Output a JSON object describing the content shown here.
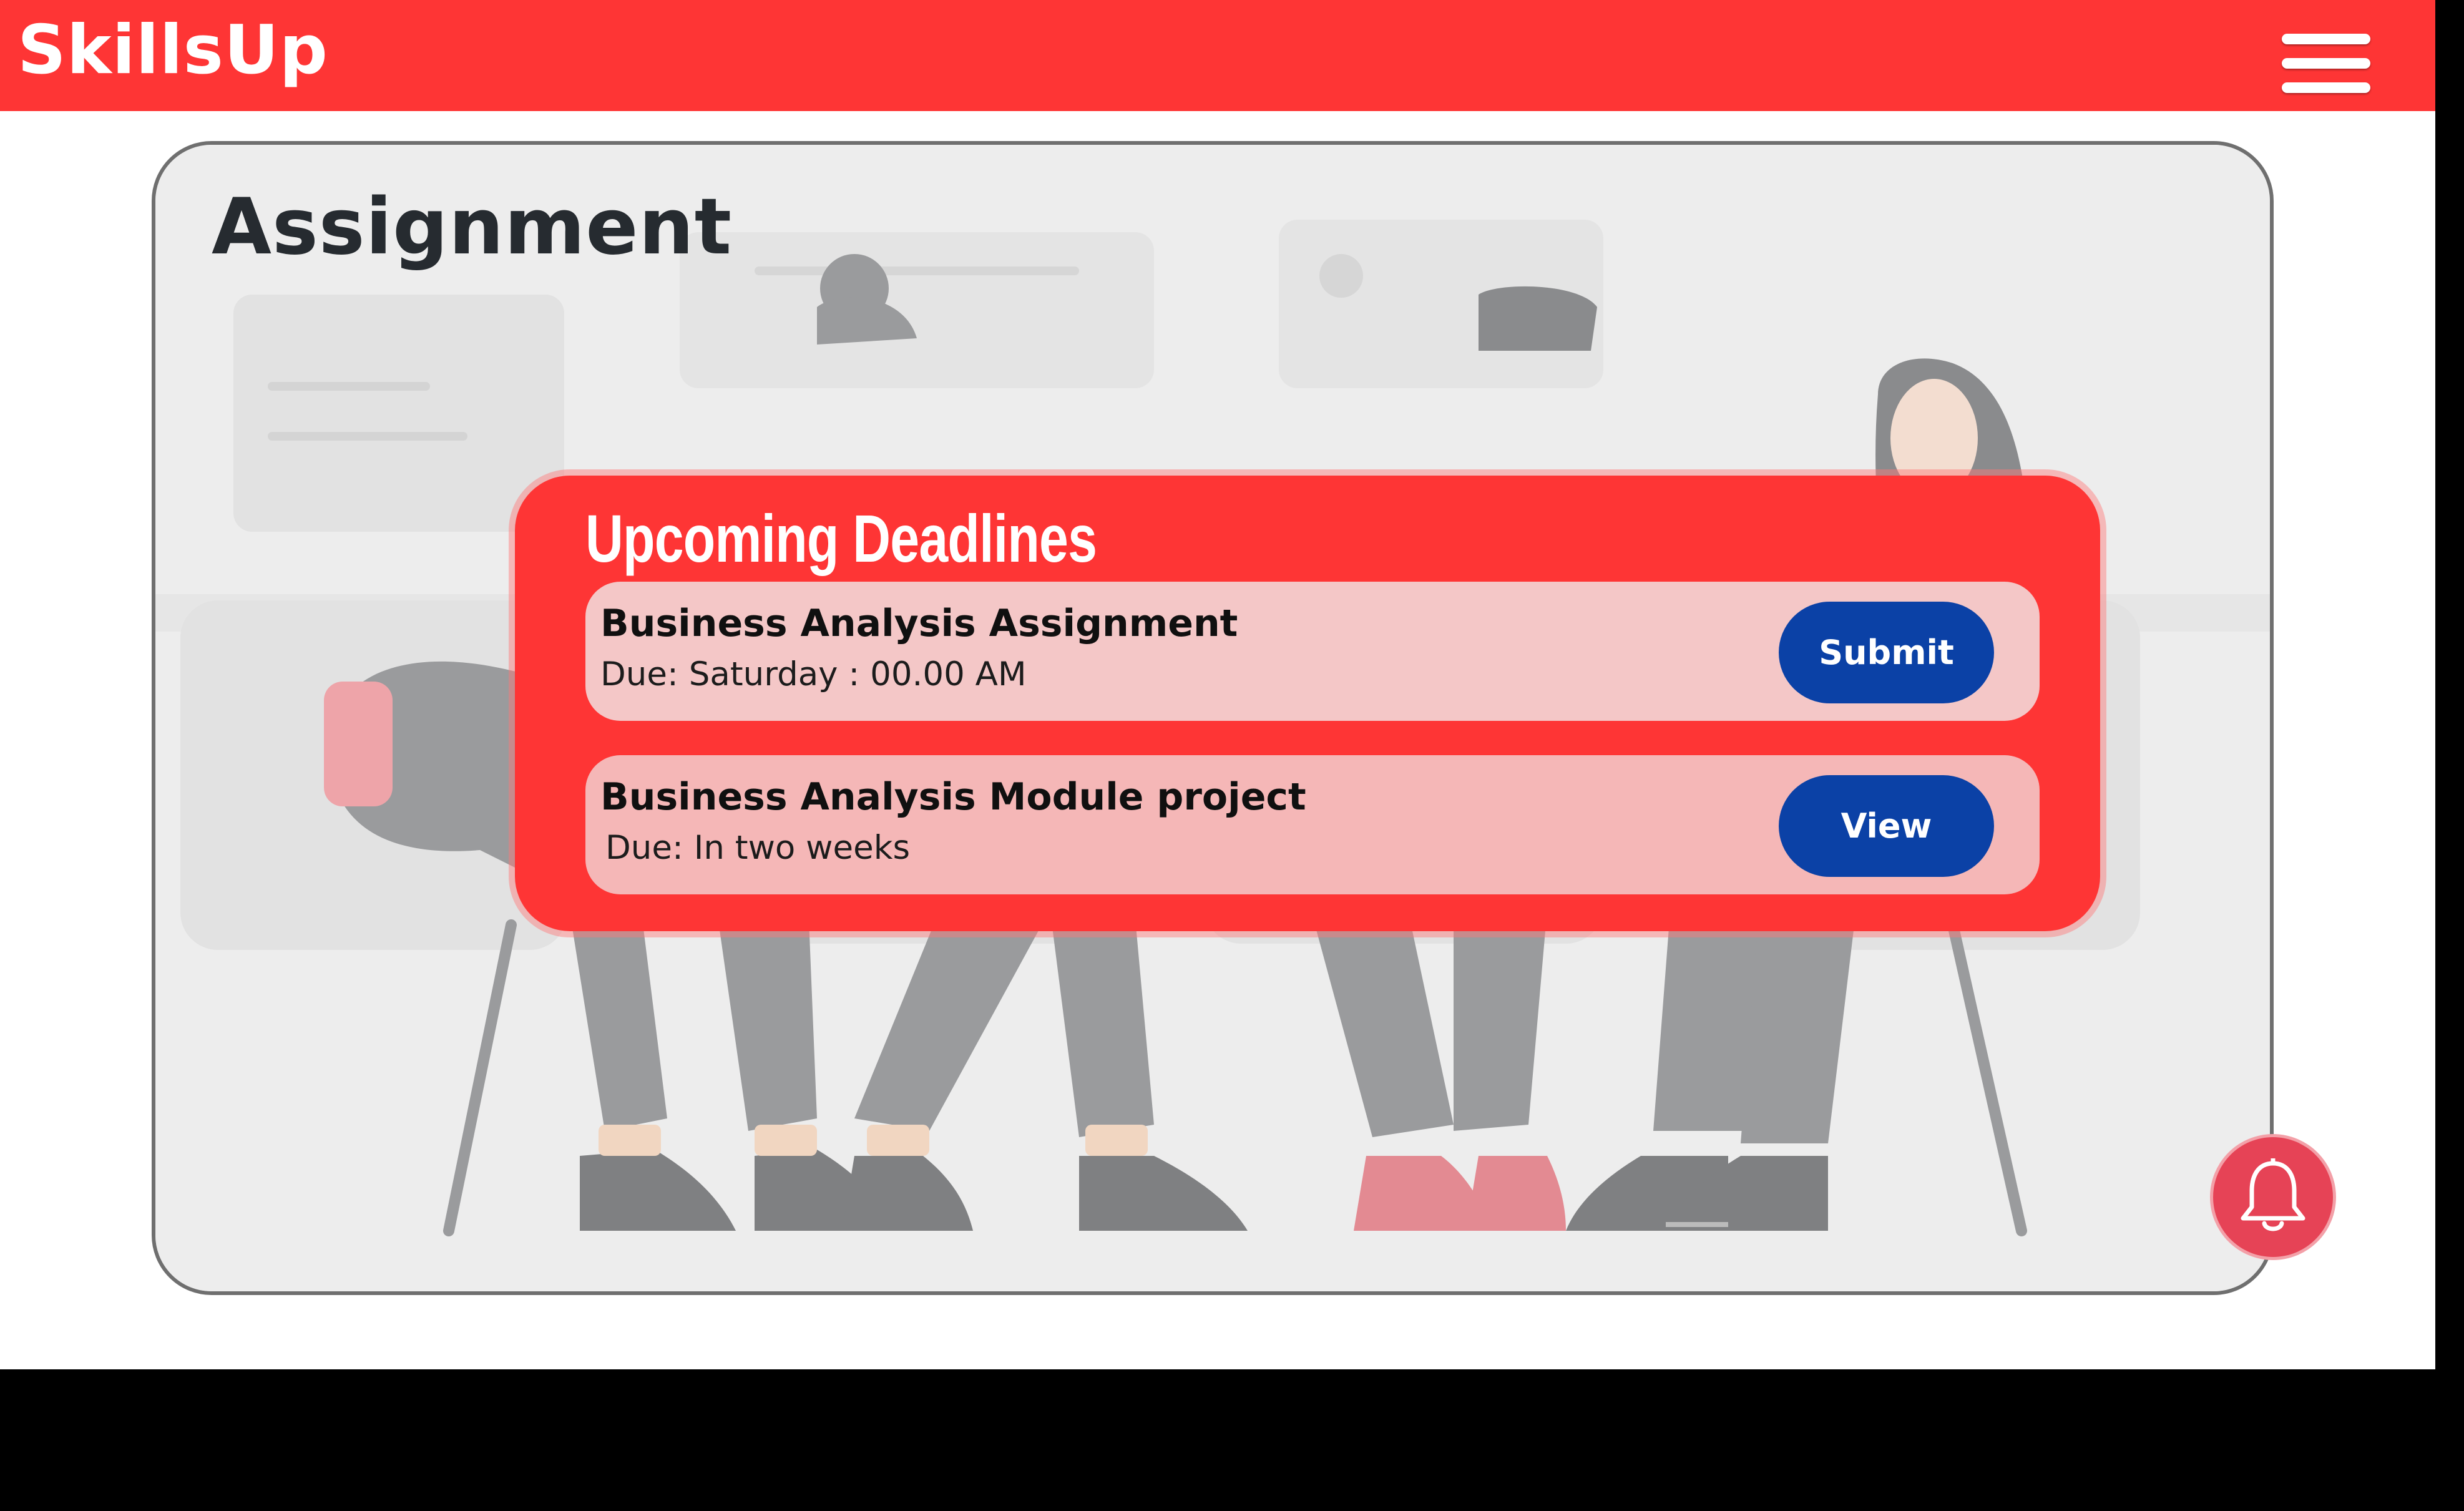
{
  "app": {
    "brand": "SkillsUp",
    "menu_icon": "hamburger-menu-icon",
    "accent_color": "#fe3535",
    "button_color": "#0b41a6"
  },
  "page": {
    "title": "Assignment"
  },
  "deadlines": {
    "title": "Upcoming Deadlines",
    "items": [
      {
        "name": "Business Analysis Assignment",
        "due": "Due: Saturday : 00.00 AM",
        "action": "Submit"
      },
      {
        "name": "Business Analysis Module project",
        "due": "Due: In two weeks",
        "action": "View"
      }
    ]
  },
  "notifications": {
    "icon": "bell-icon"
  }
}
